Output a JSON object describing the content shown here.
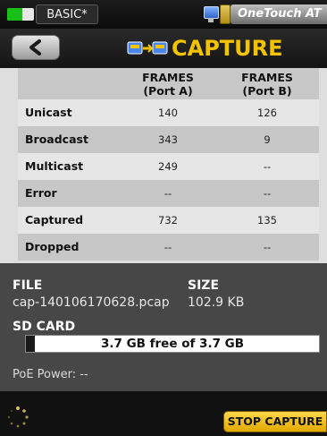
{
  "status_bar": {
    "battery_level": 0.58,
    "profile_label": "BASIC*",
    "device_name": "OneTouch AT"
  },
  "title_bar": {
    "title": "CAPTURE"
  },
  "table": {
    "headers": {
      "port_a": [
        "FRAMES",
        "(Port A)"
      ],
      "port_b": [
        "FRAMES",
        "(Port B)"
      ]
    },
    "rows": [
      {
        "label": "Unicast",
        "a": "140",
        "b": "126"
      },
      {
        "label": "Broadcast",
        "a": "343",
        "b": "9"
      },
      {
        "label": "Multicast",
        "a": "249",
        "b": "--"
      },
      {
        "label": "Error",
        "a": "--",
        "b": "--"
      },
      {
        "label": "Captured",
        "a": "732",
        "b": "135"
      },
      {
        "label": "Dropped",
        "a": "--",
        "b": "--"
      }
    ]
  },
  "file": {
    "file_label": "FILE",
    "size_label": "SIZE",
    "name": "cap-140106170628.pcap",
    "size": "102.9 KB"
  },
  "sd_card": {
    "label": "SD CARD",
    "usage_text": "3.7 GB free of 3.7 GB",
    "used_fraction": 0.01
  },
  "poe": {
    "text": "PoE Power: --"
  },
  "footer": {
    "stop_label": "STOP CAPTURE"
  },
  "colors": {
    "title_yellow": "#f2c300",
    "button_yellow": "#ffd64a",
    "battery_green": "#17c017"
  }
}
